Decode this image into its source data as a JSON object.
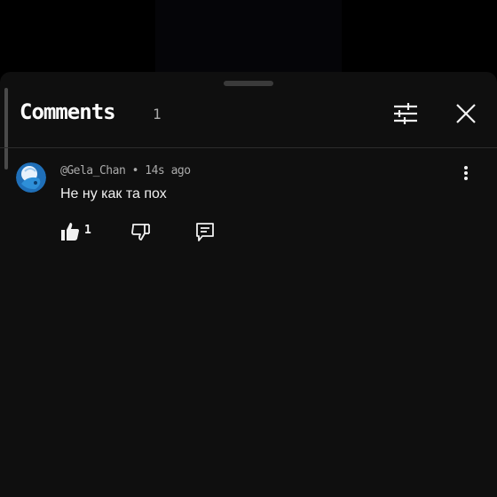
{
  "header": {
    "title": "Comments",
    "count": "1",
    "icons": [
      "sliders-icon",
      "close-icon"
    ]
  },
  "comments": [
    {
      "handle": "@Gela_Chan",
      "separator": " • ",
      "time": "14s ago",
      "text": "Не ну как та пох",
      "likes": "1",
      "icons": [
        "avatar",
        "more-vertical-icon",
        "thumbs-up-icon",
        "thumbs-down-icon",
        "reply-icon"
      ]
    }
  ],
  "colors": {
    "sheet_background": "#0f0f0f",
    "primary_text": "#f1f1f1",
    "secondary_text": "#aaaaaa",
    "divider": "#2c2c2c",
    "avatar_accent": "#2e8fd8"
  }
}
